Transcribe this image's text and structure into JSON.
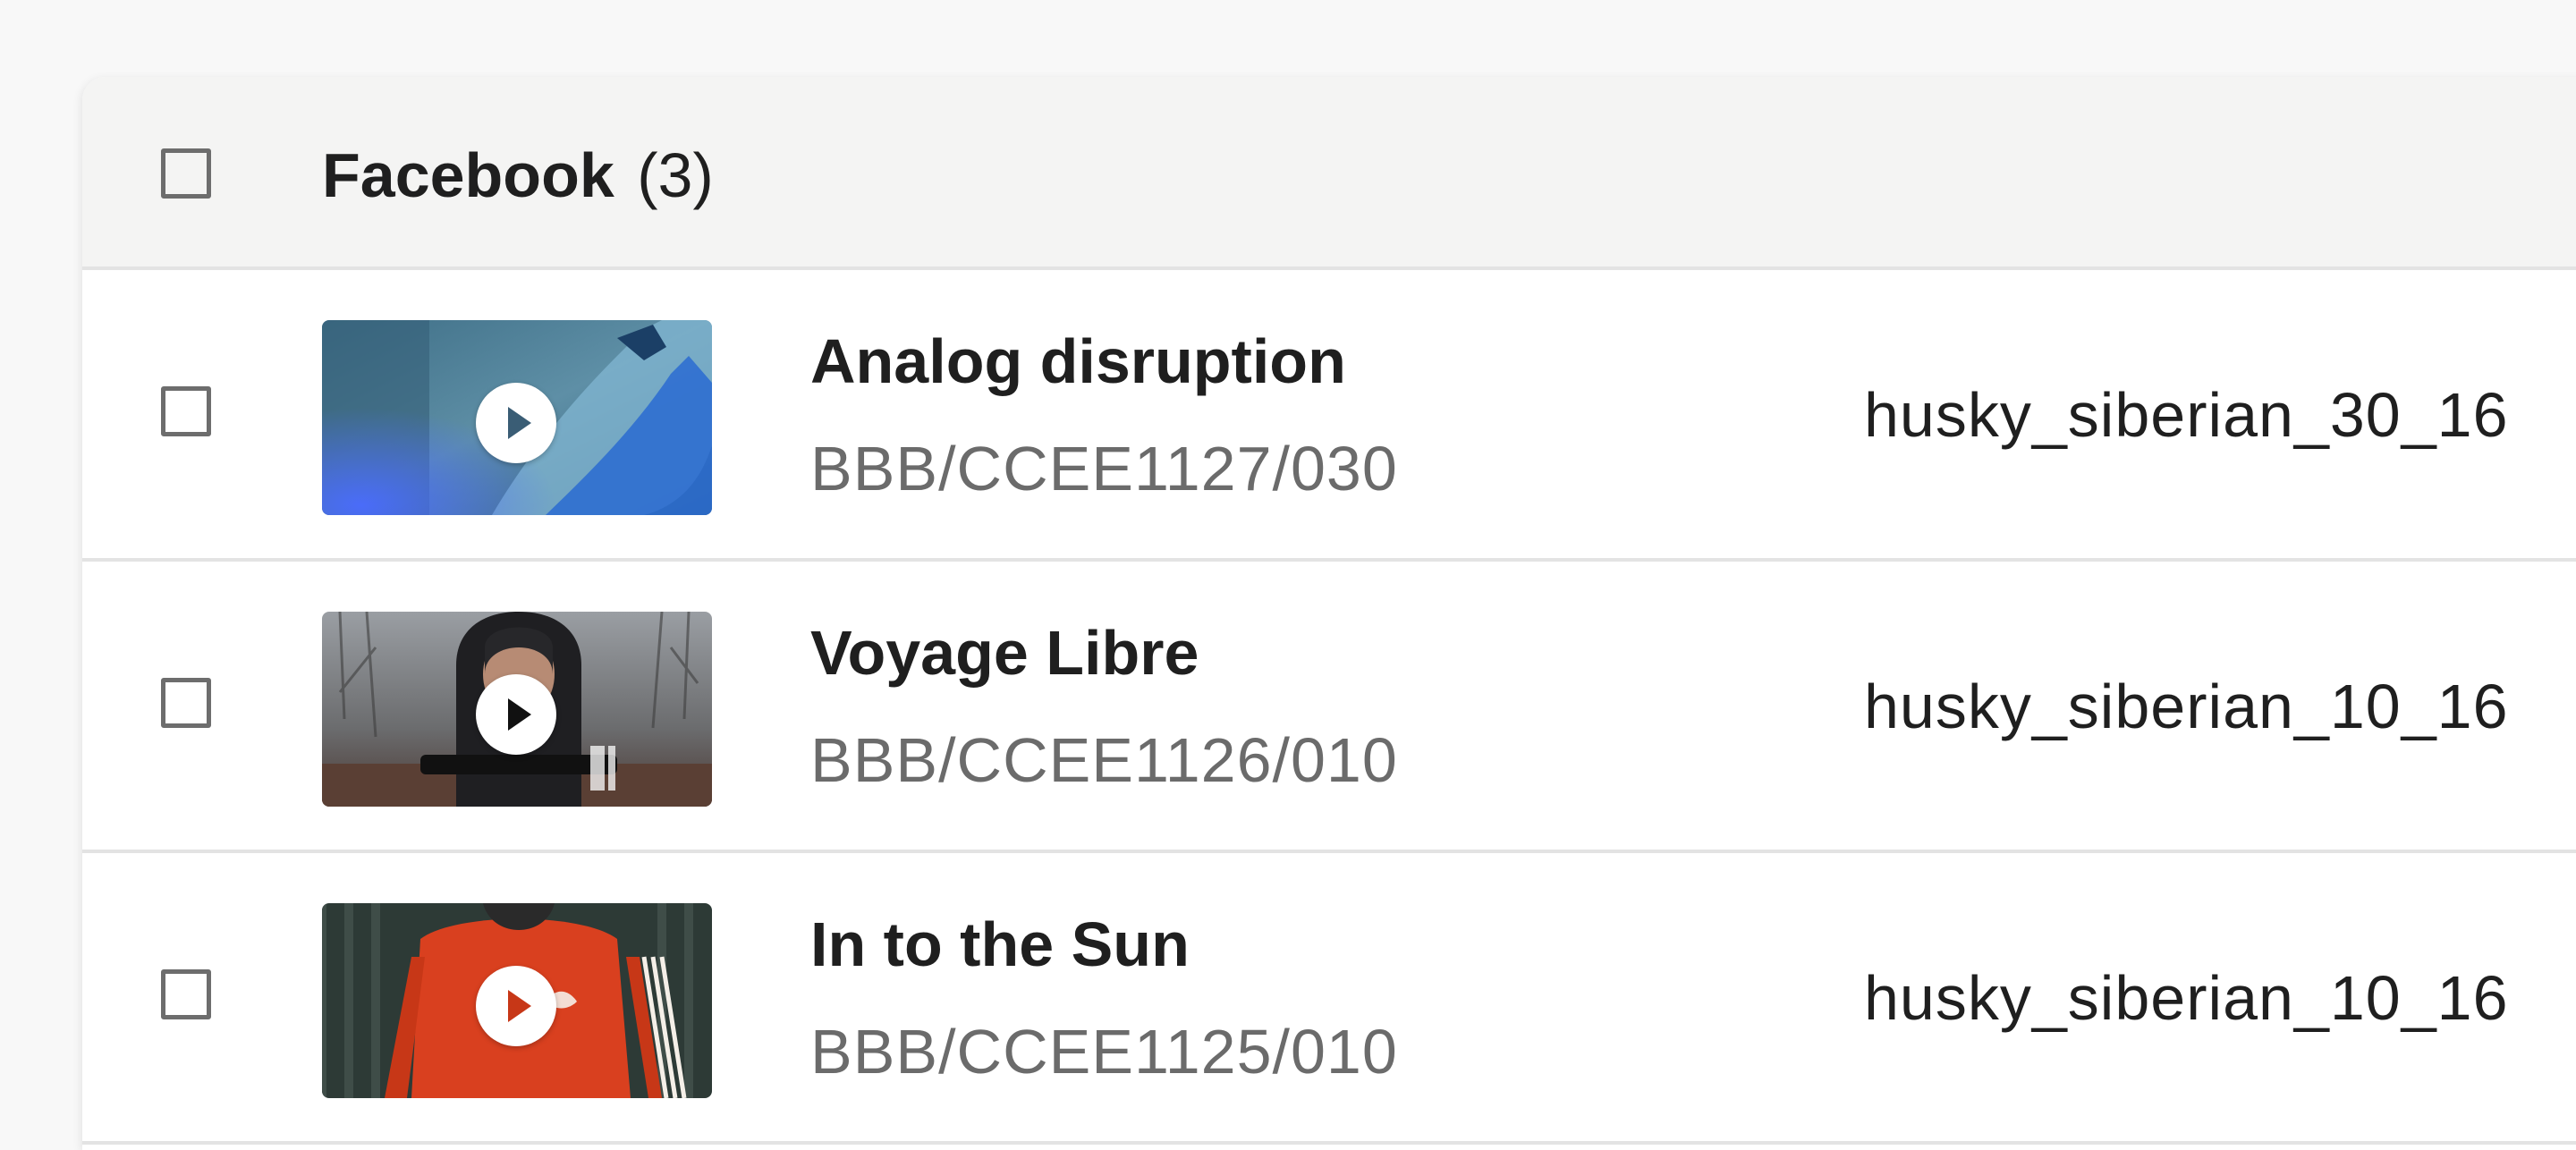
{
  "group": {
    "name": "Facebook",
    "count": "(3)"
  },
  "rows": [
    {
      "title": "Analog disruption",
      "code": "BBB/CCEE1127/030",
      "file": "husky_siberian_30_16"
    },
    {
      "title": "Voyage Libre",
      "code": "BBB/CCEE1126/010",
      "file": "husky_siberian_10_16"
    },
    {
      "title": "In to the Sun",
      "code": "BBB/CCEE1125/010",
      "file": "husky_siberian_10_16"
    }
  ],
  "icons": {
    "checkbox": "checkbox-icon",
    "play": "play-icon"
  }
}
